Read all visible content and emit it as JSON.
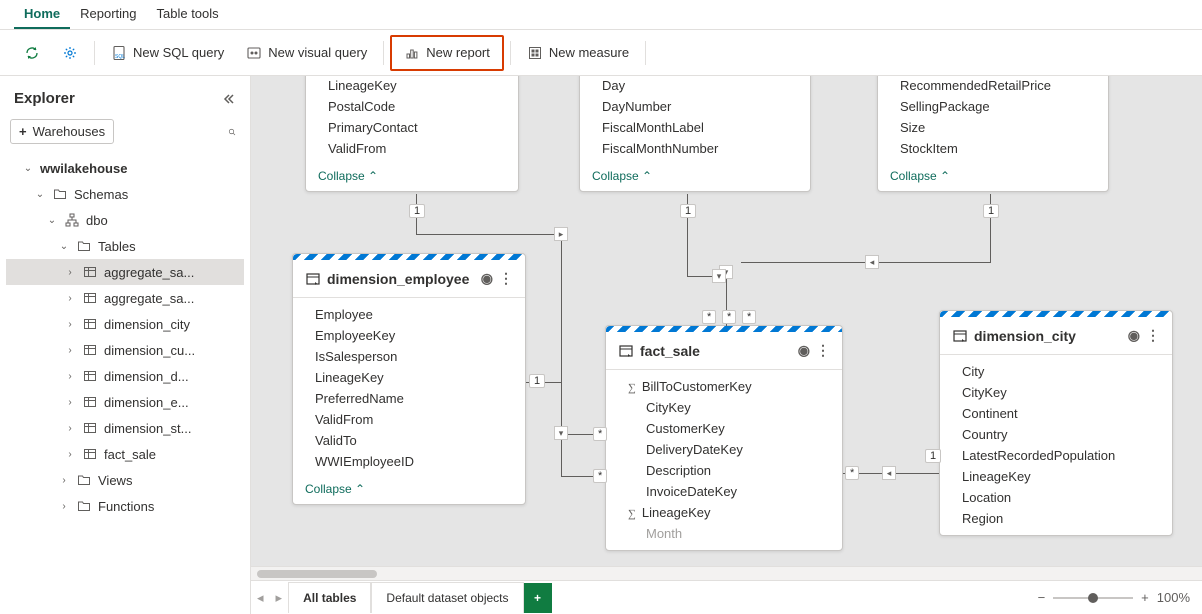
{
  "tabs": {
    "home": "Home",
    "reporting": "Reporting",
    "table_tools": "Table tools"
  },
  "toolbar": {
    "refresh": "",
    "settings": "",
    "new_sql": "New SQL query",
    "new_visual": "New visual query",
    "new_report": "New report",
    "new_measure": "New measure"
  },
  "explorer": {
    "title": "Explorer",
    "warehouses_btn": "Warehouses",
    "tree": {
      "root": "wwilakehouse",
      "schemas": "Schemas",
      "dbo": "dbo",
      "tables_label": "Tables",
      "tables": [
        "aggregate_sa...",
        "aggregate_sa...",
        "dimension_city",
        "dimension_cu...",
        "dimension_d...",
        "dimension_e...",
        "dimension_st...",
        "fact_sale"
      ],
      "views": "Views",
      "functions": "Functions"
    }
  },
  "entities": {
    "top1": {
      "fields": [
        "LineageKey",
        "PostalCode",
        "PrimaryContact",
        "ValidFrom"
      ],
      "collapse": "Collapse"
    },
    "top2": {
      "fields": [
        "Day",
        "DayNumber",
        "FiscalMonthLabel",
        "FiscalMonthNumber"
      ],
      "collapse": "Collapse"
    },
    "top3": {
      "fields": [
        "RecommendedRetailPrice",
        "SellingPackage",
        "Size",
        "StockItem"
      ],
      "collapse": "Collapse"
    },
    "employee": {
      "title": "dimension_employee",
      "fields": [
        "Employee",
        "EmployeeKey",
        "IsSalesperson",
        "LineageKey",
        "PreferredName",
        "ValidFrom",
        "ValidTo",
        "WWIEmployeeID"
      ],
      "collapse": "Collapse"
    },
    "fact_sale": {
      "title": "fact_sale",
      "fields_sigma": [
        true,
        false,
        false,
        false,
        false,
        false,
        true,
        false
      ],
      "fields": [
        "BillToCustomerKey",
        "CityKey",
        "CustomerKey",
        "DeliveryDateKey",
        "Description",
        "InvoiceDateKey",
        "LineageKey",
        "Month"
      ]
    },
    "city": {
      "title": "dimension_city",
      "fields": [
        "City",
        "CityKey",
        "Continent",
        "Country",
        "LatestRecordedPopulation",
        "LineageKey",
        "Location",
        "Region"
      ]
    }
  },
  "rel": {
    "one": "1",
    "many": "*"
  },
  "bottom": {
    "all_tables": "All tables",
    "default_dataset": "Default dataset objects",
    "zoom": "100%"
  }
}
